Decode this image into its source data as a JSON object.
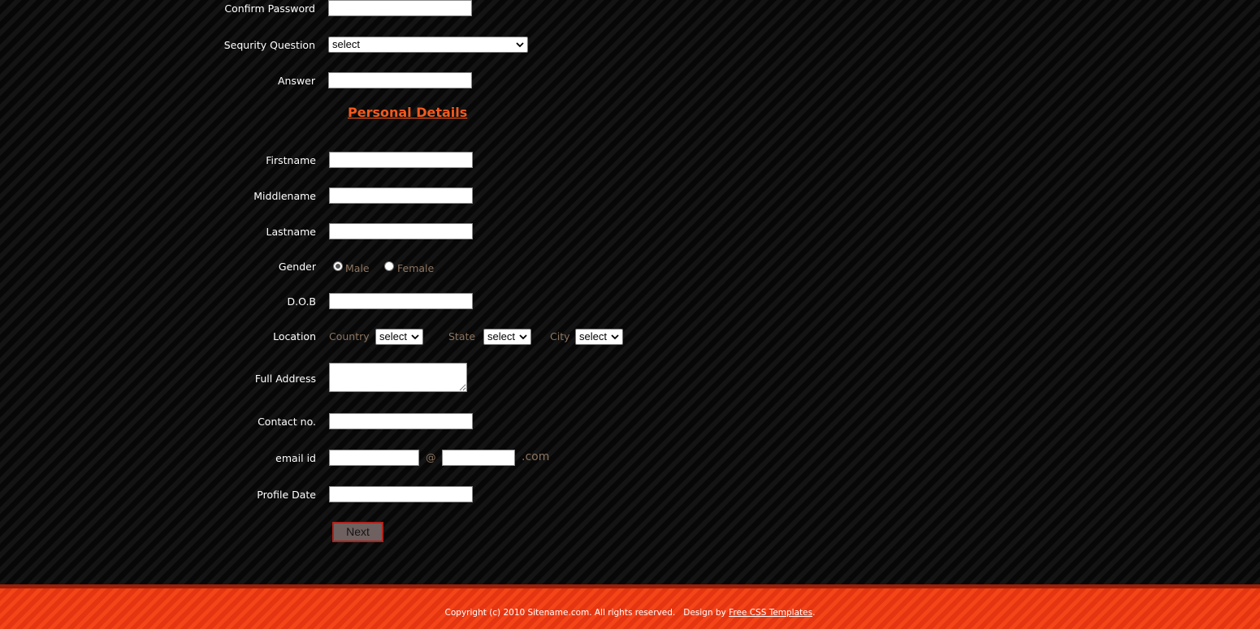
{
  "account_fields": {
    "confirm_password_label": "Confirm Password",
    "security_question_label": "Sequrity Question",
    "security_question_value": "select",
    "answer_label": "Answer"
  },
  "personal_details": {
    "heading": "Personal Details",
    "firstname_label": "Firstname",
    "middlename_label": "Middlename",
    "lastname_label": "Lastname",
    "gender_label": "Gender",
    "gender_male": "Male",
    "gender_female": "Female",
    "gender_selected": "Male",
    "dob_label": "D.O.B",
    "location_label": "Location",
    "country_label": "Country",
    "country_value": "select",
    "state_label": "State",
    "state_value": "select",
    "city_label": "City",
    "city_value": "select",
    "full_address_label": "Full Address",
    "contact_label": "Contact no.",
    "email_label": "email id",
    "email_at": "@",
    "email_suffix": ".com",
    "profile_date_label": "Profile Date",
    "next_label": "Next"
  },
  "footer": {
    "copyright": "Copyright (c) 2010 Sitename.com. All rights reserved.",
    "design_by": "Design by",
    "link_text": "Free CSS Templates",
    "period": "."
  },
  "colors": {
    "accent": "#f45a1e",
    "footer_bg": "#ee3a10",
    "muted_text": "#8d7560"
  }
}
